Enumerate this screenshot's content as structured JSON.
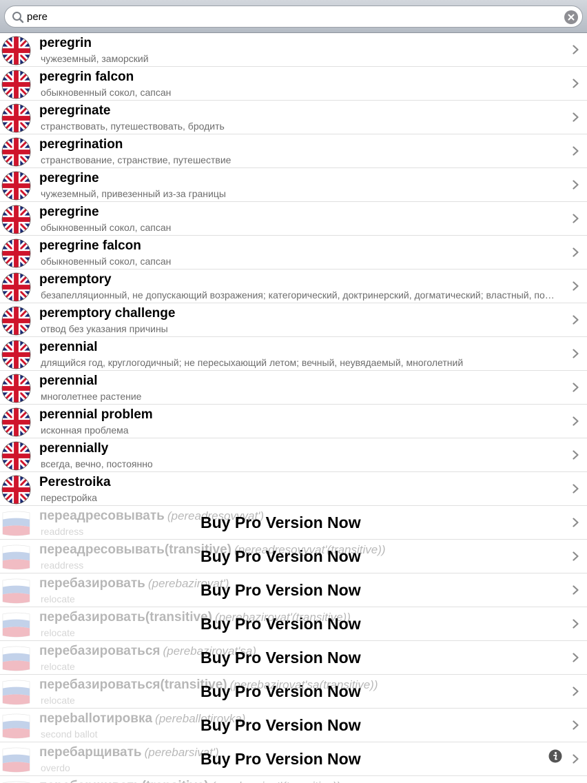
{
  "search": {
    "value": "pere",
    "icon": "search-icon",
    "clear_icon": "clear-icon"
  },
  "colors": {
    "bar_top": "#d3d7dd",
    "bar_bottom": "#b4bbc4",
    "subtitle": "#6d6d6d",
    "chevron": "#8c8c8c",
    "separator": "#e0e0e0"
  },
  "english_entries": [
    {
      "word": "peregrin",
      "translation": "чужеземный, заморский"
    },
    {
      "word": "peregrin falcon",
      "translation": "обыкновенный сокол, сапсан"
    },
    {
      "word": "peregrinate",
      "translation": "странствовать, путешествовать, бродить"
    },
    {
      "word": "peregrination",
      "translation": "странствование, странствие, путешествие"
    },
    {
      "word": "peregrine",
      "translation": "чужеземный, привезенный из-за границы"
    },
    {
      "word": "peregrine",
      "translation": "обыкновенный сокол, сапсан"
    },
    {
      "word": "peregrine falcon",
      "translation": "обыкновенный сокол, сапсан"
    },
    {
      "word": "peremptory",
      "translation": "безапелляционный, не допускающий возражения; категорический, доктринерский, догматический; властный, повелительный"
    },
    {
      "word": "peremptory challenge",
      "translation": "отвод без указания причины"
    },
    {
      "word": "perennial",
      "translation": "длящийся год, круглогодичный; не пересыхающий летом; вечный, неувядаемый, многолетний"
    },
    {
      "word": "perennial",
      "translation": "многолетнее растение"
    },
    {
      "word": "perennial problem",
      "translation": "исконная проблема"
    },
    {
      "word": "perennially",
      "translation": "всегда, вечно, постоянно"
    },
    {
      "word": "Perestroika",
      "translation": "перестройка"
    }
  ],
  "russian_entries": [
    {
      "word": "переадресовывать",
      "translit": "(pereadresovyvat')",
      "translation": "readdress",
      "promo": "Buy Pro Version Now"
    },
    {
      "word": "переадресовывать(transitive)",
      "translit": "(pereadresovyvat'(transitive))",
      "translation": "readdress",
      "promo": "Buy Pro Version Now"
    },
    {
      "word": "перебазировать",
      "translit": "(perebazirovat')",
      "translation": "relocate",
      "promo": "Buy Pro Version Now"
    },
    {
      "word": "перебазировать(transitive)",
      "translit": "(perebazirovat'(transitive))",
      "translation": "relocate",
      "promo": "Buy Pro Version Now"
    },
    {
      "word": "перебазироваться",
      "translit": "(perebazirovat'sa)",
      "translation": "relocate",
      "promo": "Buy Pro Version Now"
    },
    {
      "word": "перебазироваться(transitive)",
      "translit": "(perebazirovat'sa(transitive))",
      "translation": "relocate",
      "promo": "Buy Pro Version Now"
    },
    {
      "word": "переballотировка",
      "translit": "(pereballotirovka)",
      "translation": "second ballot",
      "promo": "Buy Pro Version Now"
    },
    {
      "word": "перебарщивать",
      "translit": "(perebarsivat')",
      "translation": "overdo",
      "promo": "Buy Pro Version Now"
    },
    {
      "word": "перебарщивать(transitive)",
      "translit": "(perebarsivat'(transitive))",
      "translation": "",
      "promo": ""
    }
  ],
  "info_icon": "info-icon",
  "row_icons": {
    "english": "uk-flag-icon",
    "russian": "russian-flag-icon",
    "disclosure": "chevron-right-icon"
  }
}
